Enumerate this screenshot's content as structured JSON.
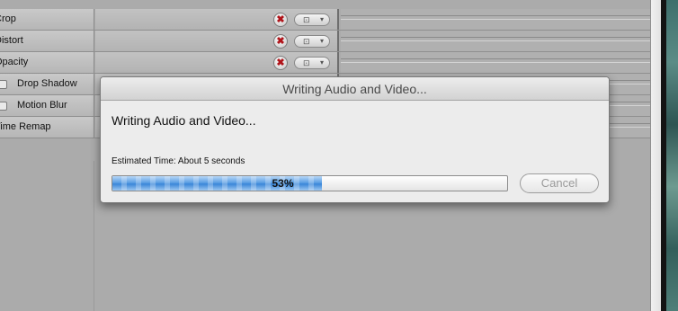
{
  "rows": [
    {
      "label": "Crop",
      "checkbox": false
    },
    {
      "label": "Distort",
      "checkbox": false
    },
    {
      "label": "Opacity",
      "checkbox": false
    },
    {
      "label": "Drop Shadow",
      "checkbox": true
    },
    {
      "label": "Motion Blur",
      "checkbox": true
    },
    {
      "label": "Time Remap",
      "checkbox": false
    }
  ],
  "row_icons": {
    "reset": "reset-x-icon",
    "keyframe": "keyframe-menu-icon",
    "reset_glyph": "✖",
    "keyframe_glyph": "⊡",
    "dropdown_glyph": "▾"
  },
  "dialog": {
    "title": "Writing Audio and Video...",
    "headline": "Writing Audio and Video...",
    "estimate": "Estimated Time: About 5 seconds",
    "progress_value": 0.53,
    "progress_label": "53%",
    "cancel_label": "Cancel",
    "cancel_enabled": false
  },
  "colors": {
    "progress_fill": "#3a86d9",
    "reset_icon": "#b0141a"
  }
}
